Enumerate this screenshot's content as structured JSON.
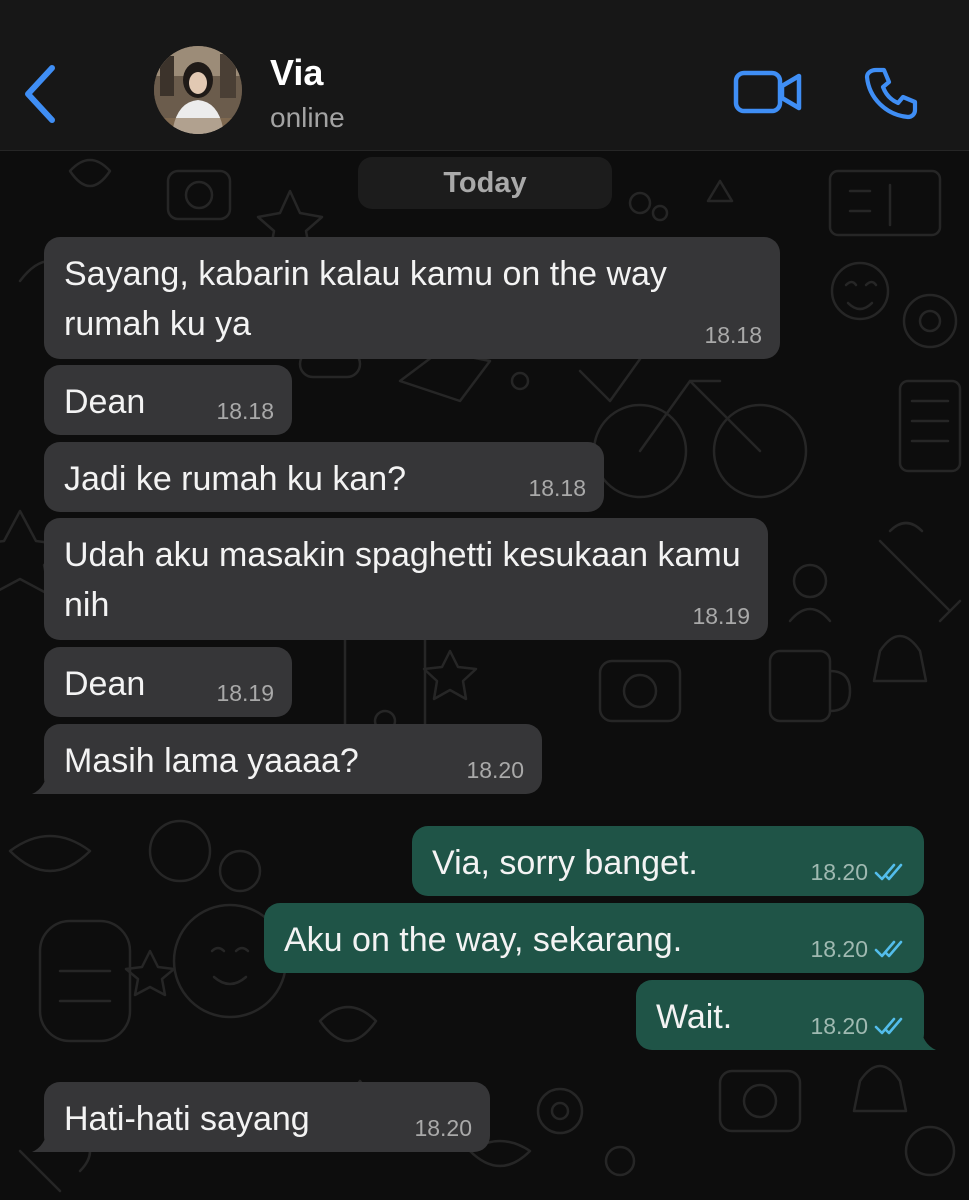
{
  "header": {
    "contact_name": "Via",
    "status": "online",
    "back_icon": "chevron-left-icon",
    "video_icon": "video-camera-icon",
    "call_icon": "phone-icon"
  },
  "chat": {
    "date_label": "Today",
    "messages": [
      {
        "direction": "in",
        "text": "Sayang, kabarin kalau kamu on the way rumah ku ya",
        "time": "18.18"
      },
      {
        "direction": "in",
        "text": "Dean",
        "time": "18.18"
      },
      {
        "direction": "in",
        "text": "Jadi ke rumah ku kan?",
        "time": "18.18"
      },
      {
        "direction": "in",
        "text": "Udah aku masakin spaghetti kesukaan kamu nih",
        "time": "18.19"
      },
      {
        "direction": "in",
        "text": "Dean",
        "time": "18.19"
      },
      {
        "direction": "in",
        "text": "Masih lama yaaaa?",
        "time": "18.20"
      },
      {
        "direction": "out",
        "text": "Via, sorry banget.",
        "time": "18.20",
        "read": true
      },
      {
        "direction": "out",
        "text": "Aku on the way, sekarang.",
        "time": "18.20",
        "read": true
      },
      {
        "direction": "out",
        "text": "Wait.",
        "time": "18.20",
        "read": true
      },
      {
        "direction": "in",
        "text": "Hati-hati sayang",
        "time": "18.20"
      }
    ]
  },
  "colors": {
    "accent": "#3f8ef5",
    "incoming_bubble": "#363638",
    "outgoing_bubble": "#1f5447",
    "read_ticks": "#53bdeb"
  }
}
